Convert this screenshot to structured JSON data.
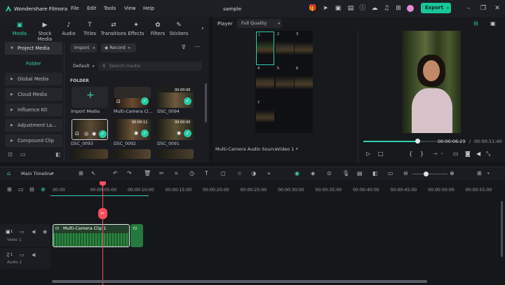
{
  "app": {
    "name": "Wondershare Filmora",
    "menu": [
      "File",
      "Edit",
      "Tools",
      "View",
      "Help"
    ],
    "project_title": "sample",
    "export_label": "Export"
  },
  "media_tabs": [
    {
      "label": "Media",
      "icon": "media-icon"
    },
    {
      "label": "Stock Media",
      "icon": "stock-media-icon"
    },
    {
      "label": "Audio",
      "icon": "audio-icon"
    },
    {
      "label": "Titles",
      "icon": "titles-icon"
    },
    {
      "label": "Transitions",
      "icon": "transitions-icon"
    },
    {
      "label": "Effects",
      "icon": "effects-icon"
    },
    {
      "label": "Filters",
      "icon": "filters-icon"
    },
    {
      "label": "Stickers",
      "icon": "stickers-icon"
    }
  ],
  "sidebar": {
    "project_media": "Project Media",
    "folder": "Folder",
    "items": [
      "Global Media",
      "Cloud Media",
      "Influence Kit",
      "Adjustment La...",
      "Compound Clip"
    ]
  },
  "media_toolbar": {
    "import": "Import",
    "record": "Record",
    "sort": "Default",
    "search_placeholder": "Search media",
    "section": "FOLDER"
  },
  "media_items": [
    {
      "label": "Import Media",
      "duration": ""
    },
    {
      "label": "Multi-Camera Cl...",
      "duration": ""
    },
    {
      "label": "DSC_0094",
      "duration": "00:00:00"
    },
    {
      "label": "DSC_0093",
      "duration": ""
    },
    {
      "label": "DSC_0092",
      "duration": "00:00:11"
    },
    {
      "label": "DSC_0091",
      "duration": "00:00:00"
    }
  ],
  "player": {
    "label": "Player",
    "quality": "Full Quality",
    "grid_numbers": [
      "1",
      "2",
      "3",
      "4",
      "5",
      "6",
      "7"
    ],
    "audio_source_label": "Multi-Camera Audio Source",
    "audio_source_value": "Video 1",
    "current_time": "00:00:06:29",
    "separator": "/",
    "total_time": "00:00:11:40",
    "progress_fraction": 0.55
  },
  "timeline": {
    "main_label": "Main Timeline",
    "ticks": [
      "00:00",
      "00:00:05:00",
      "00:00:10:00",
      "00:00:15:00",
      "00:00:20:00",
      "00:00:25:00",
      "00:00:30:00",
      "00:00:35:00",
      "00:00:40:00",
      "00:00:45:00",
      "00:00:50:00",
      "00:00:55:00"
    ],
    "clip_label": "Multi-Camera Clip 1",
    "video_track": "Video 1",
    "audio_track": "Audio 1",
    "track_number_video": "1",
    "track_number_audio": "1"
  },
  "colors": {
    "accent": "#1fcfa8",
    "playhead": "#ff4d5e",
    "export": "#18c79a"
  }
}
